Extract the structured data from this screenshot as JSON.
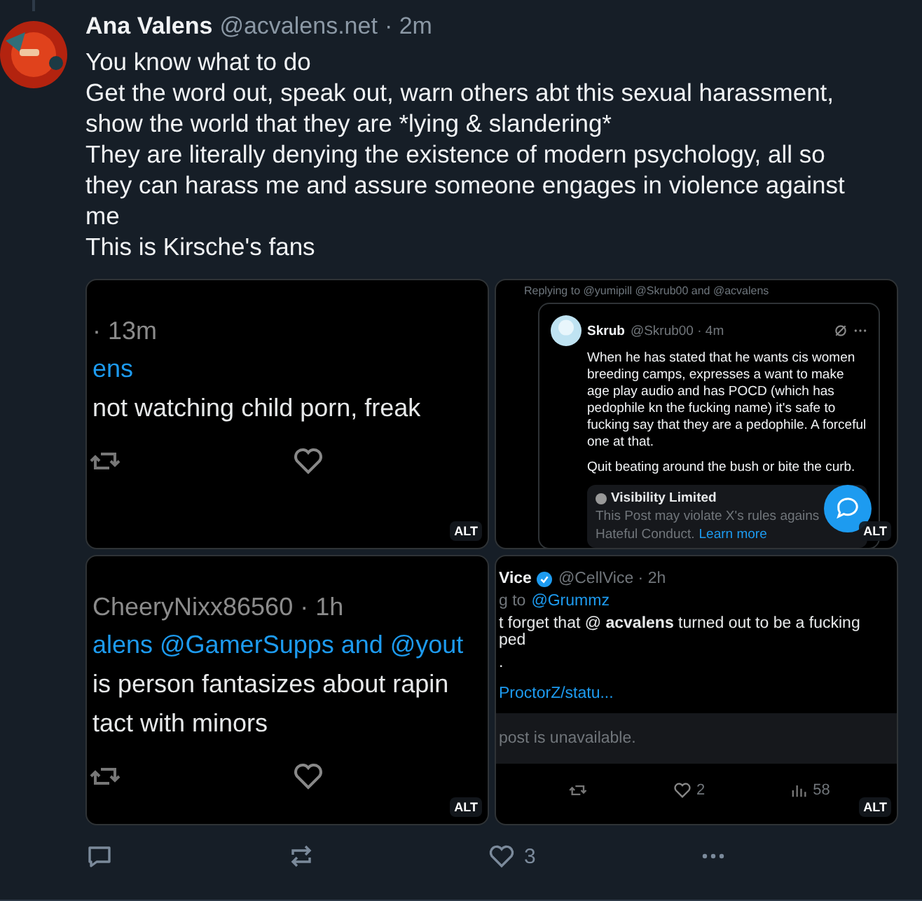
{
  "post": {
    "author": "Ana Valens",
    "handle": "@acvalens.net",
    "time": "· 2m",
    "lines": [
      "You know what to do",
      "Get the word out, speak out, warn others abt this sexual harassment, show the world that they are *lying & slandering*",
      "They are literally denying the existence of modern psychology, all so they can harass me and assure someone engages in violence against me",
      "This is Kirsche's fans"
    ]
  },
  "images": [
    {
      "kind": "tweet",
      "meta": "· 13m",
      "mention": "ens",
      "body": [
        "not watching child porn, freak"
      ],
      "alt": "ALT"
    },
    {
      "kind": "quote",
      "replying": "Replying to @yumipill @Skrub00 and @acvalens",
      "name": "Skrub",
      "meta": "@Skrub00 · 4m",
      "body": [
        "When he has stated that he wants cis women breeding camps, expresses a want to make age play audio and has POCD (which has pedophile kn the fucking name) it's safe to fucking say that they are a pedophile. A forceful one at that.",
        "Quit beating around the bush or bite the curb."
      ],
      "notice_title": "Visibility Limited",
      "notice_text": "This Post may violate X's rules agains",
      "notice_tail": "Hateful Conduct.",
      "notice_link": "Learn more",
      "alt": "ALT"
    },
    {
      "kind": "tweet",
      "meta": "CheeryNixx86560 · 1h",
      "mention": "alens @GamerSupps and @yout",
      "body": [
        "is person fantasizes about rapin",
        "tact with minors"
      ],
      "alt": "ALT"
    },
    {
      "kind": "unavailable",
      "name": "Vice",
      "verified": true,
      "meta": "@CellVice · 2h",
      "replying": "g to",
      "mention": "@Grummz",
      "body": [
        "t forget that @ **acvalens** turned out to be a fucking ped",
        "."
      ],
      "link": "ProctorZ/statu...",
      "notice_text": "post is unavailable.",
      "likes": "2",
      "views": "58",
      "alt": "ALT"
    }
  ],
  "actions": {
    "like_count": "3"
  }
}
